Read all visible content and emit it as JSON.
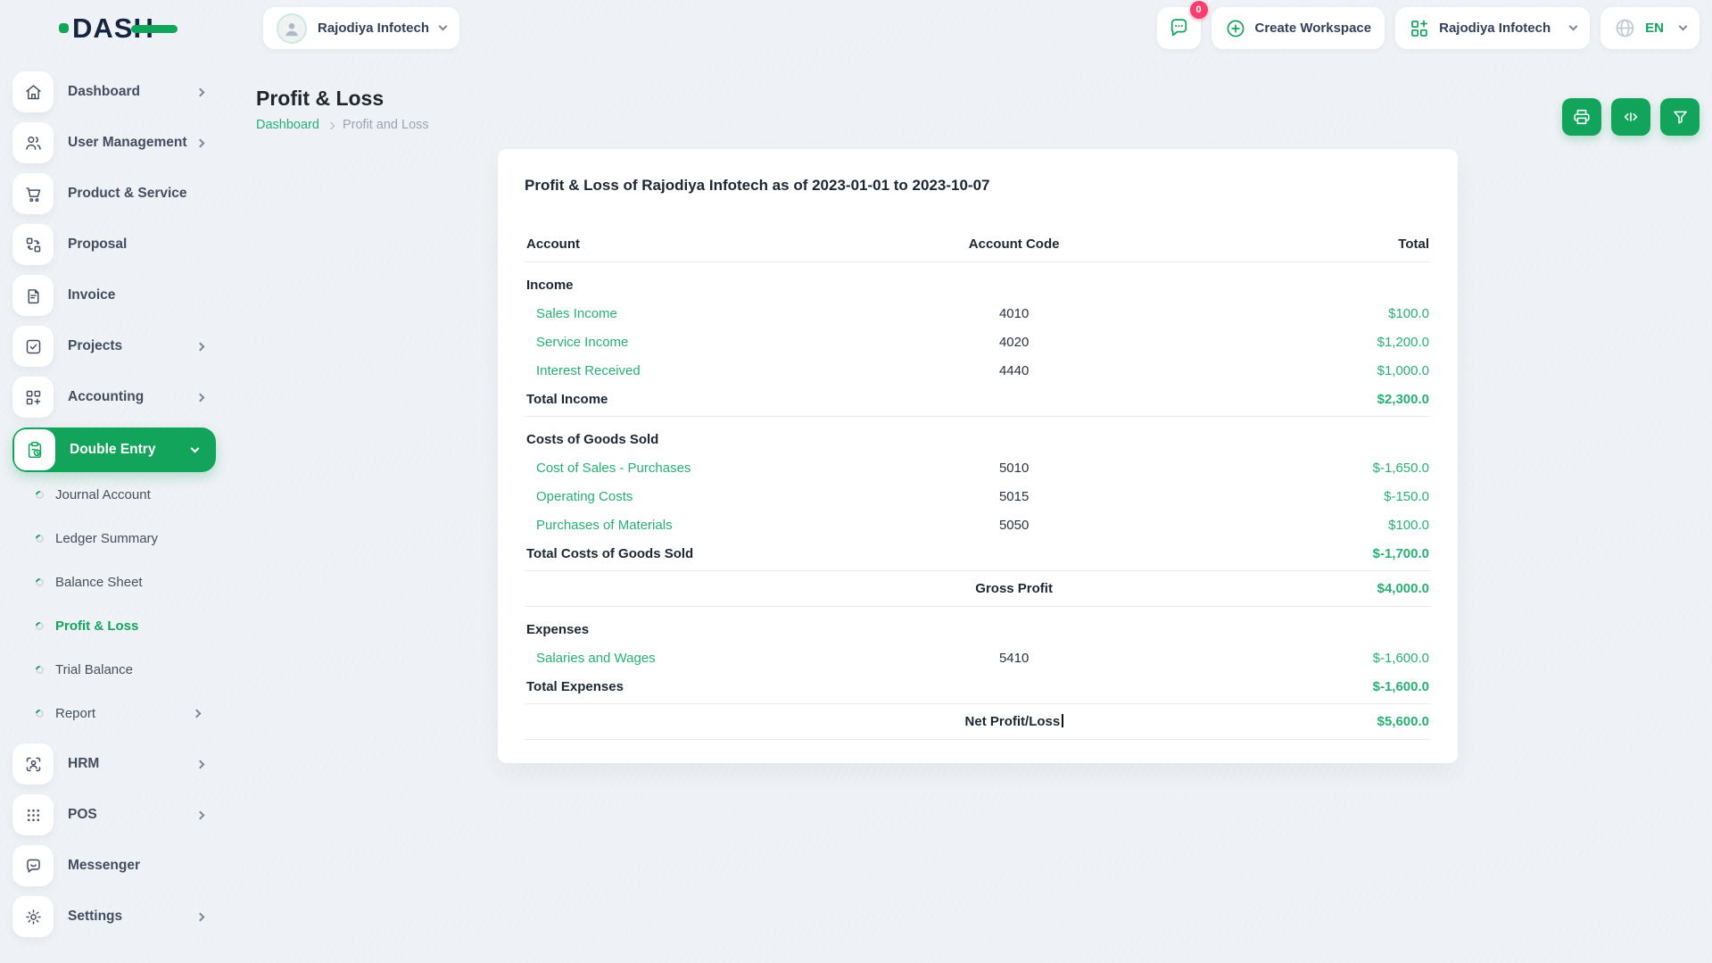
{
  "colors": {
    "accent": "#13a45c",
    "link_green": "#27b072",
    "badge_pink": "#fb3e6e"
  },
  "brand": {
    "logo_text": "DAS"
  },
  "topbar": {
    "company": {
      "name": "Rajodiya Infotech"
    },
    "chat": {
      "badge": "0"
    },
    "create_workspace": {
      "label": "Create Workspace"
    },
    "workspace": {
      "name": "Rajodiya Infotech"
    },
    "language": {
      "code": "EN"
    }
  },
  "page": {
    "title": "Profit & Loss",
    "breadcrumb": {
      "home": "Dashboard",
      "current": "Profit and Loss"
    }
  },
  "sidebar": {
    "items": [
      {
        "label": "Dashboard"
      },
      {
        "label": "User Management"
      },
      {
        "label": "Product & Service"
      },
      {
        "label": "Proposal"
      },
      {
        "label": "Invoice"
      },
      {
        "label": "Projects"
      },
      {
        "label": "Accounting"
      },
      {
        "label": "Double Entry"
      }
    ],
    "sub_items": [
      {
        "label": "Journal Account"
      },
      {
        "label": "Ledger Summary"
      },
      {
        "label": "Balance Sheet"
      },
      {
        "label": "Profit & Loss"
      },
      {
        "label": "Trial Balance"
      },
      {
        "label": "Report"
      }
    ],
    "bottom_items": [
      {
        "label": "HRM"
      },
      {
        "label": "POS"
      },
      {
        "label": "Messenger"
      },
      {
        "label": "Settings"
      }
    ]
  },
  "report": {
    "card_title": "Profit & Loss of Rajodiya Infotech as of 2023-01-01 to 2023-10-07",
    "columns": {
      "account": "Account",
      "code": "Account Code",
      "total": "Total"
    },
    "rows": [
      {
        "account": "Income",
        "code": "",
        "total": ""
      },
      {
        "account": "Sales Income",
        "code": "4010",
        "total": "$100.0"
      },
      {
        "account": "Service Income",
        "code": "4020",
        "total": "$1,200.0"
      },
      {
        "account": "Interest Received",
        "code": "4440",
        "total": "$1,000.0"
      },
      {
        "account": "Total Income",
        "code": "",
        "total": "$2,300.0"
      },
      {
        "account": "Costs of Goods Sold",
        "code": "",
        "total": ""
      },
      {
        "account": "Cost of Sales - Purchases",
        "code": "5010",
        "total": "$-1,650.0"
      },
      {
        "account": "Operating Costs",
        "code": "5015",
        "total": "$-150.0"
      },
      {
        "account": "Purchases of Materials",
        "code": "5050",
        "total": "$100.0"
      },
      {
        "account": "Total Costs of Goods Sold",
        "code": "",
        "total": "$-1,700.0"
      },
      {
        "account": "",
        "code": "Gross Profit",
        "total": "$4,000.0"
      },
      {
        "account": "Expenses",
        "code": "",
        "total": ""
      },
      {
        "account": "Salaries and Wages",
        "code": "5410",
        "total": "$-1,600.0"
      },
      {
        "account": "Total Expenses",
        "code": "",
        "total": "$-1,600.0"
      },
      {
        "account": "",
        "code": "Net Profit/Loss",
        "total": "$5,600.0"
      }
    ]
  }
}
